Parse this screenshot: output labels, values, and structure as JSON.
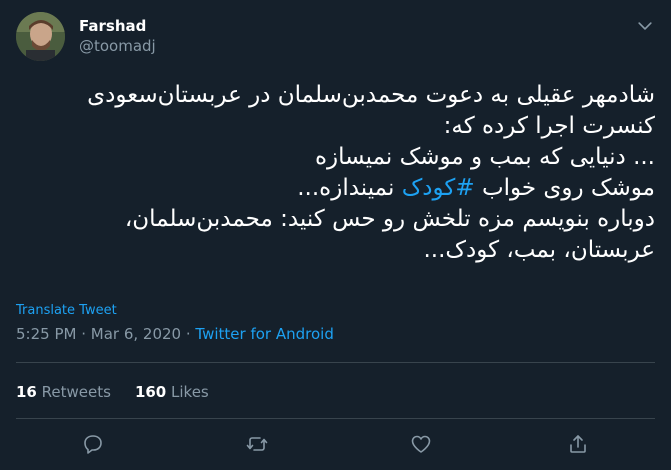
{
  "author": {
    "display_name": "Farshad",
    "handle": "@toomadj"
  },
  "tweet": {
    "lines": [
      "شادمهر عقیلی به دعوت محمدبن‌سلمان در عربستان‌سعودی",
      "کنسرت اجرا کرده که:",
      "... دنیایی که بمب و موشک نمیسازه",
      "موشک روی خواب ",
      "دوباره بنویسم مزه تلخش رو حس کنید: محمدبن‌سلمان،",
      "عربستان، بمب، کودک..."
    ],
    "hashtag": "#کودک",
    "line4_suffix": " نمیندازه..."
  },
  "translate_label": "Translate Tweet",
  "meta": {
    "time": "5:25 PM",
    "separator": " · ",
    "date": "Mar 6, 2020",
    "app": "Twitter for Android"
  },
  "stats": {
    "retweets_count": "16",
    "retweets_label": "Retweets",
    "likes_count": "160",
    "likes_label": "Likes"
  },
  "actions": [
    "reply-icon",
    "retweet-icon",
    "like-icon",
    "share-icon"
  ],
  "colors": {
    "background": "#15202b",
    "accent": "#1da1f2",
    "secondary_text": "#8899a6",
    "divider": "#38444d"
  }
}
